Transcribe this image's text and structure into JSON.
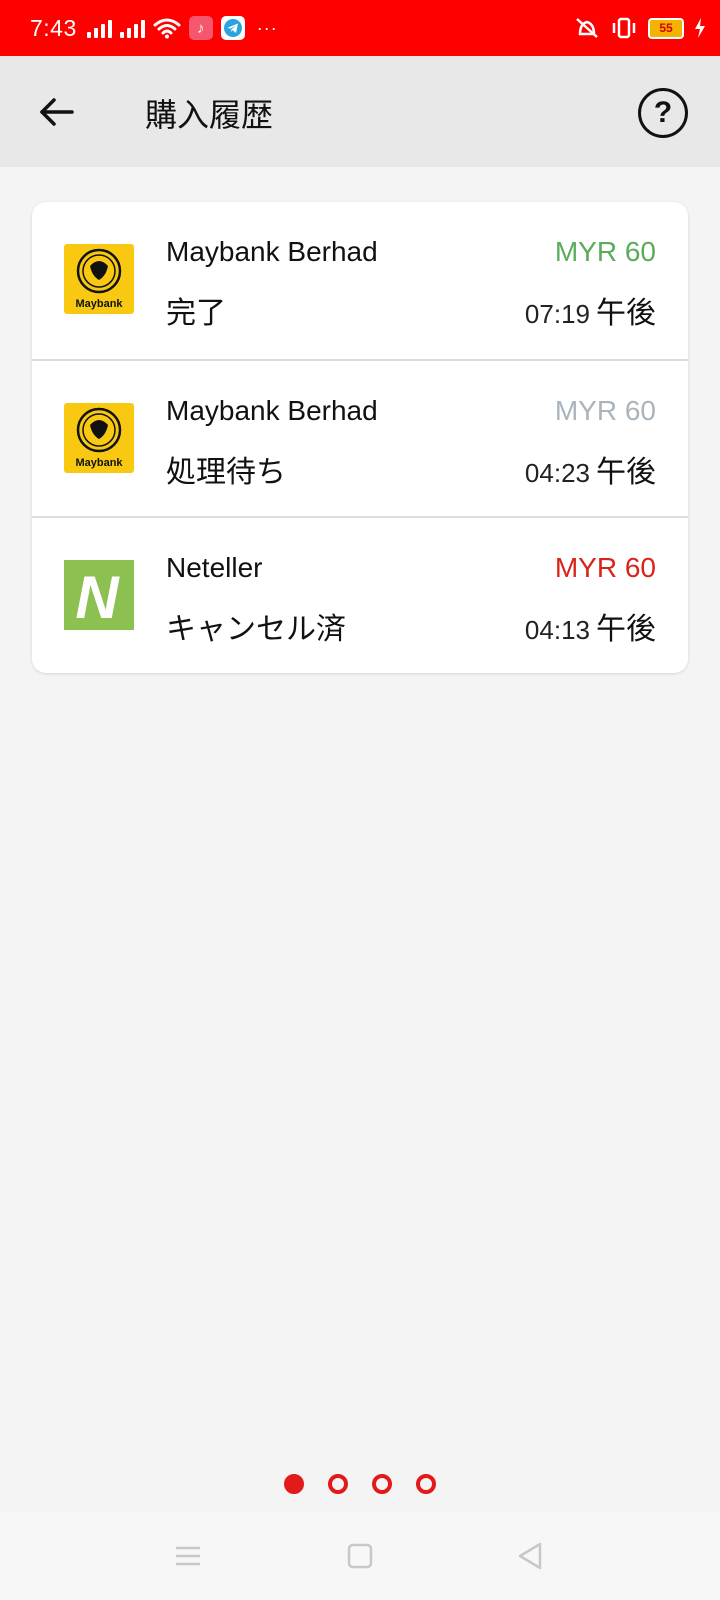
{
  "status_bar": {
    "time": "7:43",
    "battery_level": "55",
    "status_bar_color": "#fe0000"
  },
  "header": {
    "title": "購入履歴",
    "back_icon": "arrow-left-icon",
    "help_icon": "question-circle-icon",
    "help_glyph": "?"
  },
  "transactions": [
    {
      "merchant": "Maybank Berhad",
      "status": "完了",
      "amount": "MYR 60",
      "amount_color": "#5aac5a",
      "time": "07:19",
      "period": "午後",
      "logo": "maybank-logo",
      "logo_text": "Maybank"
    },
    {
      "merchant": "Maybank Berhad",
      "status": "処理待ち",
      "amount": "MYR 60",
      "amount_color": "#aab4bc",
      "time": "04:23",
      "period": "午後",
      "logo": "maybank-logo",
      "logo_text": "Maybank"
    },
    {
      "merchant": "Neteller",
      "status": "キャンセル済",
      "amount": "MYR 60",
      "amount_color": "#d9241c",
      "time": "04:13",
      "period": "午後",
      "logo": "neteller-logo",
      "logo_text": "N"
    }
  ],
  "pager": {
    "pages": 4,
    "active": 1,
    "color": "#e21a1a"
  },
  "nav_bar": {
    "items": [
      "menu-icon",
      "home-square-icon",
      "back-triangle-icon"
    ]
  }
}
